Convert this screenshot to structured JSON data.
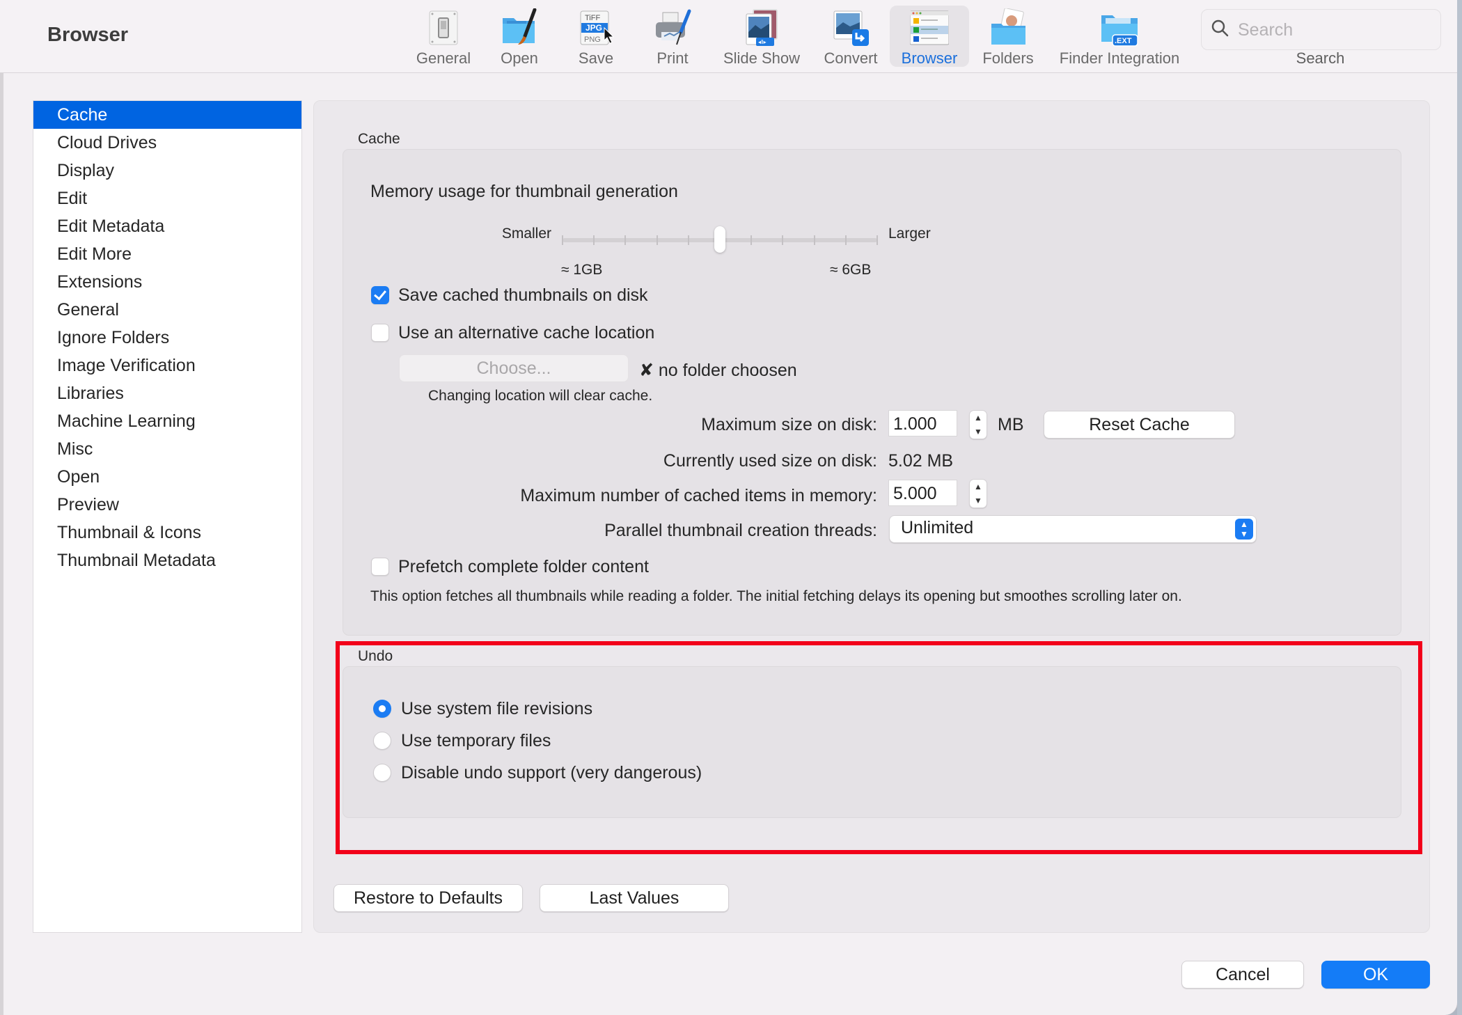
{
  "window": {
    "title": "Browser"
  },
  "toolbar": {
    "items": [
      {
        "label": "General",
        "icon": "toggle-switch-icon"
      },
      {
        "label": "Open",
        "icon": "folder-brush-icon"
      },
      {
        "label": "Save",
        "icon": "file-formats-icon"
      },
      {
        "label": "Print",
        "icon": "printer-icon"
      },
      {
        "label": "Slide Show",
        "icon": "slideshow-icon"
      },
      {
        "label": "Convert",
        "icon": "convert-icon"
      },
      {
        "label": "Browser",
        "icon": "browser-list-icon",
        "active": true
      },
      {
        "label": "Folders",
        "icon": "folder-photo-icon"
      },
      {
        "label": "Finder Integration",
        "icon": "folder-ext-icon"
      }
    ],
    "search": {
      "placeholder": "Search",
      "value": "",
      "label": "Search"
    }
  },
  "sidebar": {
    "selected": "Cache",
    "items": [
      {
        "label": "Cache"
      },
      {
        "label": "Cloud Drives"
      },
      {
        "label": "Display"
      },
      {
        "label": "Edit"
      },
      {
        "label": "Edit Metadata"
      },
      {
        "label": "Edit More"
      },
      {
        "label": "Extensions"
      },
      {
        "label": "General"
      },
      {
        "label": "Ignore Folders"
      },
      {
        "label": "Image Verification"
      },
      {
        "label": "Libraries"
      },
      {
        "label": "Machine Learning"
      },
      {
        "label": "Misc"
      },
      {
        "label": "Open"
      },
      {
        "label": "Preview"
      },
      {
        "label": "Thumbnail & Icons"
      },
      {
        "label": "Thumbnail Metadata"
      }
    ]
  },
  "cache": {
    "group_label": "Cache",
    "memory_title": "Memory usage for thumbnail generation",
    "slider": {
      "min_label": "Smaller",
      "max_label": "Larger",
      "low_value": "≈ 1GB",
      "high_value": "≈ 6GB",
      "tick_count": 11,
      "value_fraction": 0.5
    },
    "save_thumbnails": {
      "label": "Save cached thumbnails on disk",
      "checked": true
    },
    "alt_location": {
      "label": "Use an alternative cache location",
      "checked": false
    },
    "choose_button": "Choose...",
    "no_folder": "✘ no folder choosen",
    "location_note": "Changing location will clear cache.",
    "max_size": {
      "label": "Maximum size on disk:",
      "value": "1.000",
      "unit": "MB"
    },
    "reset_button": "Reset Cache",
    "used_size": {
      "label": "Currently used size on disk:",
      "value": "5.02 MB"
    },
    "max_items": {
      "label": "Maximum number of cached items in memory:",
      "value": "5.000"
    },
    "threads": {
      "label": "Parallel thumbnail creation threads:",
      "value": "Unlimited"
    },
    "prefetch": {
      "label": "Prefetch complete folder content",
      "checked": false
    },
    "prefetch_note": "This option fetches all thumbnails while reading a folder. The initial fetching delays its opening but smoothes scrolling later on."
  },
  "undo": {
    "group_label": "Undo",
    "options": [
      {
        "label": "Use system file revisions",
        "selected": true
      },
      {
        "label": "Use temporary files",
        "selected": false
      },
      {
        "label": "Disable undo support (very dangerous)",
        "selected": false
      }
    ]
  },
  "actions": {
    "restore_defaults": "Restore to Defaults",
    "last_values": "Last Values",
    "cancel": "Cancel",
    "ok": "OK"
  },
  "annotation": {
    "highlight_color": "#f2001a"
  },
  "colors": {
    "accent": "#0064e1",
    "button_primary": "#147cf7"
  }
}
